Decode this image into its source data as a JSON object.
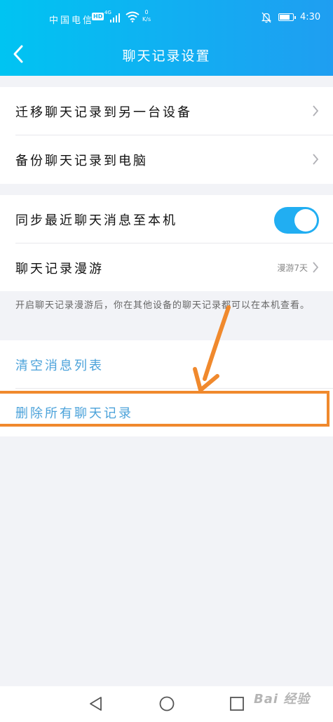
{
  "status_bar": {
    "carrier": "中国电信",
    "hd": "HD",
    "network": "4G",
    "speed_value": "0",
    "speed_unit": "K/s",
    "time": "4:30"
  },
  "header": {
    "title": "聊天记录设置"
  },
  "settings": {
    "migrate_label": "迁移聊天记录到另一台设备",
    "backup_label": "备份聊天记录到电脑",
    "sync_label": "同步最近聊天消息至本机",
    "sync_enabled": true,
    "roaming_label": "聊天记录漫游",
    "roaming_value": "漫游7天",
    "roaming_note": "开启聊天记录漫游后，你在其他设备的聊天记录都可以在本机查看。"
  },
  "actions": {
    "clear_list_label": "清空消息列表",
    "delete_all_label": "删除所有聊天记录"
  },
  "watermark": {
    "text": "Bai 经验"
  },
  "colors": {
    "header_start": "#00c4f2",
    "header_end": "#1f9ef1",
    "toggle_on": "#21aef2",
    "action_text": "#4ba2da",
    "annotation": "#f0892d"
  }
}
